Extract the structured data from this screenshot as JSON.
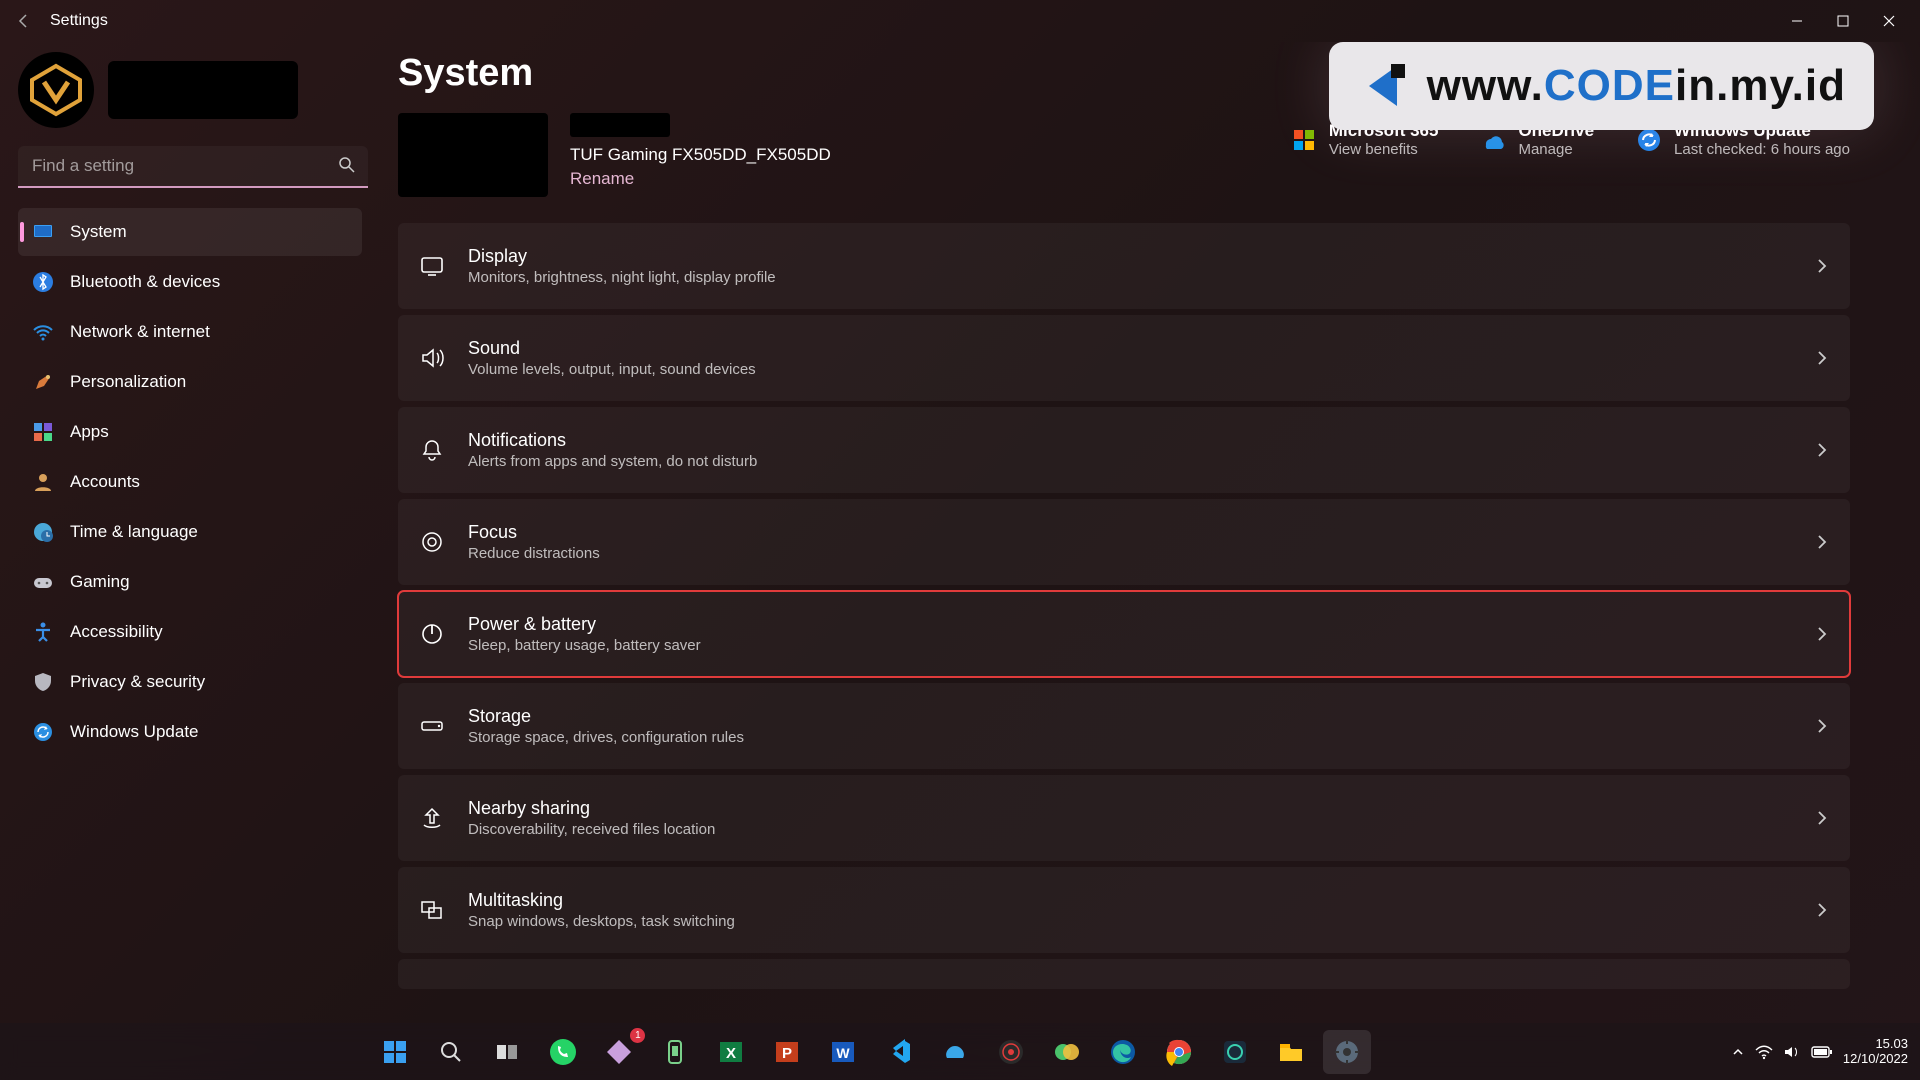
{
  "window": {
    "title": "Settings"
  },
  "search": {
    "placeholder": "Find a setting"
  },
  "page": {
    "title": "System"
  },
  "device": {
    "model": "TUF Gaming FX505DD_FX505DD",
    "rename": "Rename"
  },
  "tiles": {
    "m365": {
      "title": "Microsoft 365",
      "sub": "View benefits"
    },
    "onedrive": {
      "title": "OneDrive",
      "sub": "Manage"
    },
    "update": {
      "title": "Windows Update",
      "sub": "Last checked: 6 hours ago"
    }
  },
  "watermark": {
    "prefix": "www.",
    "code": "CODE",
    "suffix": "in.my.id"
  },
  "nav": [
    {
      "label": "System"
    },
    {
      "label": "Bluetooth & devices"
    },
    {
      "label": "Network & internet"
    },
    {
      "label": "Personalization"
    },
    {
      "label": "Apps"
    },
    {
      "label": "Accounts"
    },
    {
      "label": "Time & language"
    },
    {
      "label": "Gaming"
    },
    {
      "label": "Accessibility"
    },
    {
      "label": "Privacy & security"
    },
    {
      "label": "Windows Update"
    }
  ],
  "cards": [
    {
      "title": "Display",
      "sub": "Monitors, brightness, night light, display profile"
    },
    {
      "title": "Sound",
      "sub": "Volume levels, output, input, sound devices"
    },
    {
      "title": "Notifications",
      "sub": "Alerts from apps and system, do not disturb"
    },
    {
      "title": "Focus",
      "sub": "Reduce distractions"
    },
    {
      "title": "Power & battery",
      "sub": "Sleep, battery usage, battery saver"
    },
    {
      "title": "Storage",
      "sub": "Storage space, drives, configuration rules"
    },
    {
      "title": "Nearby sharing",
      "sub": "Discoverability, received files location"
    },
    {
      "title": "Multitasking",
      "sub": "Snap windows, desktops, task switching"
    }
  ],
  "tray": {
    "time": "15.03",
    "date": "12/10/2022"
  }
}
